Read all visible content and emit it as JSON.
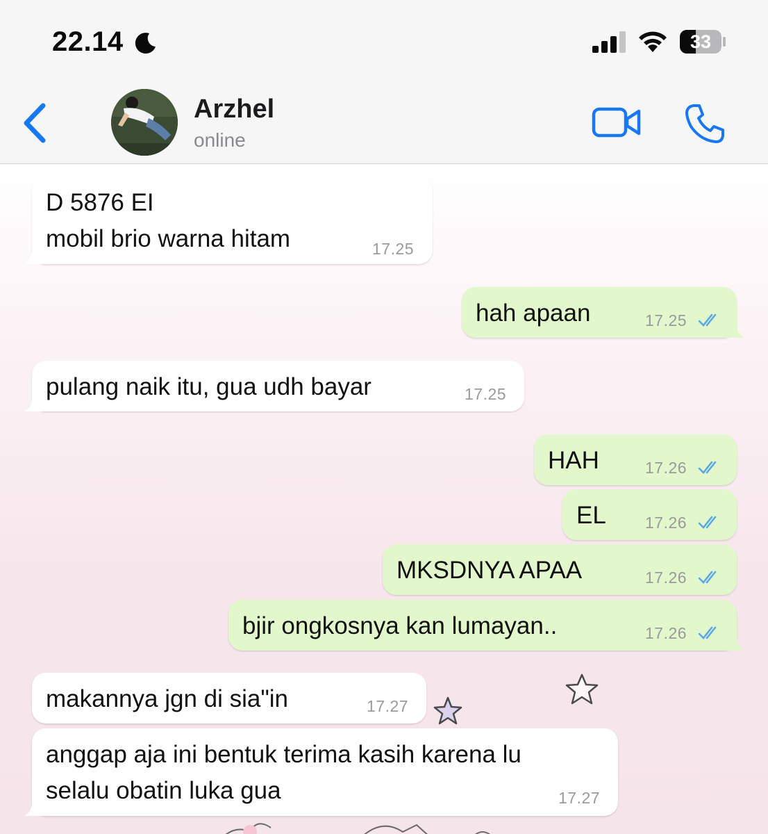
{
  "status_bar": {
    "time": "22.14",
    "battery": "33"
  },
  "header": {
    "contact_name": "Arzhel",
    "contact_status": "online"
  },
  "colors": {
    "accent": "#1877f2",
    "incoming_bubble": "#ffffff",
    "outgoing_bubble": "#e2f7cb",
    "read_ticks": "#5aa9e6"
  },
  "messages": [
    {
      "direction": "in",
      "lines": [
        "D 5876 EI",
        "mobil brio warna hitam"
      ],
      "time": "17.25"
    },
    {
      "direction": "out",
      "lines": [
        "hah apaan"
      ],
      "time": "17.25",
      "status": "read"
    },
    {
      "direction": "in",
      "lines": [
        "pulang naik itu, gua udh bayar"
      ],
      "time": "17.25"
    },
    {
      "direction": "out",
      "lines": [
        "HAH"
      ],
      "time": "17.26",
      "status": "read"
    },
    {
      "direction": "out",
      "lines": [
        "EL"
      ],
      "time": "17.26",
      "status": "read"
    },
    {
      "direction": "out",
      "lines": [
        "MKSDNYA APAA"
      ],
      "time": "17.26",
      "status": "read"
    },
    {
      "direction": "out",
      "lines": [
        "bjir ongkosnya kan lumayan.."
      ],
      "time": "17.26",
      "status": "read"
    },
    {
      "direction": "in",
      "lines": [
        "makannya jgn di sia\"in"
      ],
      "time": "17.27"
    },
    {
      "direction": "in",
      "lines": [
        "anggap aja ini bentuk terima kasih karena lu",
        "selalu obatin luka gua"
      ],
      "time": "17.27"
    }
  ]
}
